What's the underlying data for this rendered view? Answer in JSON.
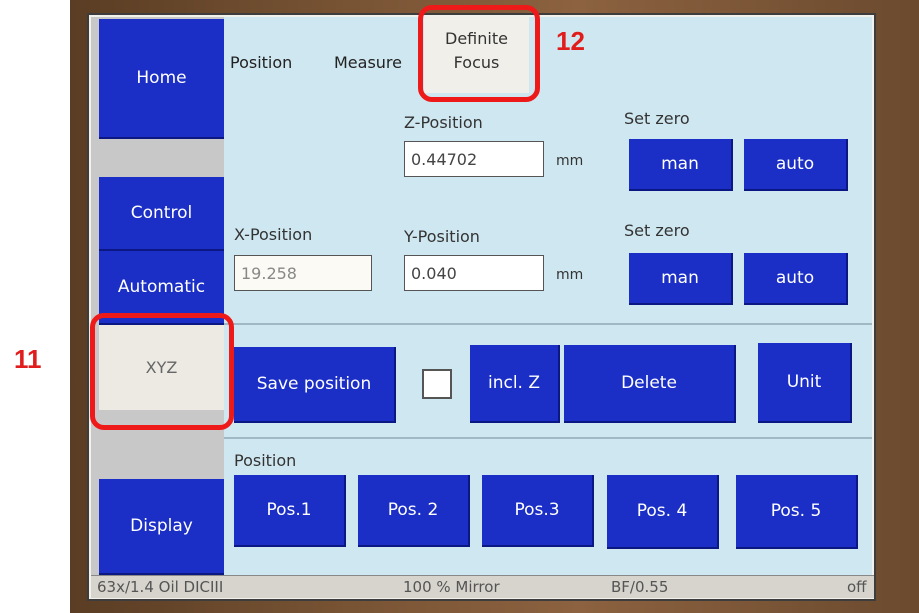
{
  "sidebar": {
    "home": "Home",
    "control": "Control",
    "automatic": "Automatic",
    "xyz": "XYZ",
    "display": "Display"
  },
  "tabs": {
    "position": "Position",
    "measure": "Measure",
    "definite_line1": "Definite",
    "definite_line2": "Focus"
  },
  "z_section": {
    "label": "Z-Position",
    "value": "0.44702",
    "unit": "mm",
    "set_zero_label": "Set zero",
    "man": "man",
    "auto": "auto"
  },
  "xy_section": {
    "x_label": "X-Position",
    "x_value": "19.258",
    "y_label": "Y-Position",
    "y_value": "0.040",
    "unit": "mm",
    "set_zero_label": "Set zero",
    "man": "man",
    "auto": "auto"
  },
  "actions": {
    "save_position": "Save position",
    "incl_z": "incl. Z",
    "delete": "Delete",
    "unit": "Unit"
  },
  "positions": {
    "label": "Position",
    "items": [
      "Pos.1",
      "Pos. 2",
      "Pos.3",
      "Pos. 4",
      "Pos. 5"
    ]
  },
  "status_bar": {
    "objective": "63x/1.4 Oil DICIII",
    "mirror": "100 % Mirror",
    "condenser": "BF/0.55",
    "state": "off"
  },
  "callouts": {
    "xyz_number": "11",
    "focus_number": "12"
  },
  "colors": {
    "button_blue": "#1b2fc6",
    "panel_bg": "#cfe7f0",
    "callout_red": "#ee1a1a"
  }
}
